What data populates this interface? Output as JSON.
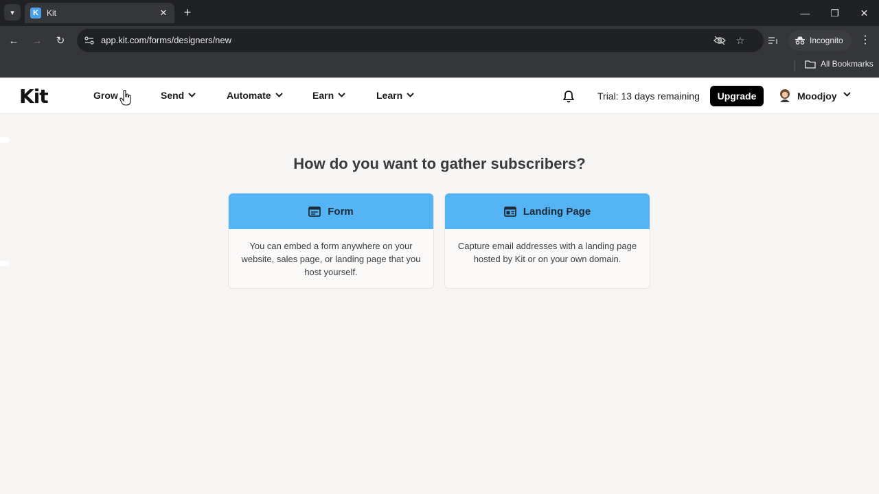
{
  "browser": {
    "tab_title": "Kit",
    "favicon_letter": "K",
    "url": "app.kit.com/forms/designers/new",
    "profile_label": "Incognito",
    "bookmarks_label": "All Bookmarks"
  },
  "app": {
    "logo": "Kit",
    "nav": [
      {
        "label": "Grow"
      },
      {
        "label": "Send"
      },
      {
        "label": "Automate"
      },
      {
        "label": "Earn"
      },
      {
        "label": "Learn"
      }
    ],
    "trial_text": "Trial: 13 days remaining",
    "upgrade_label": "Upgrade",
    "account_name": "Moodjoy"
  },
  "main": {
    "heading": "How do you want to gather subscribers?",
    "options": [
      {
        "title": "Form",
        "icon": "form-icon",
        "description": "You can embed a form anywhere on your website, sales page, or landing page that you host yourself."
      },
      {
        "title": "Landing Page",
        "icon": "landing-page-icon",
        "description": "Capture email addresses with a landing page hosted by Kit or on your own domain."
      }
    ]
  },
  "colors": {
    "card_header": "#55b4f3",
    "page_bg": "#f8f6f4",
    "upgrade_bg": "#000000"
  }
}
